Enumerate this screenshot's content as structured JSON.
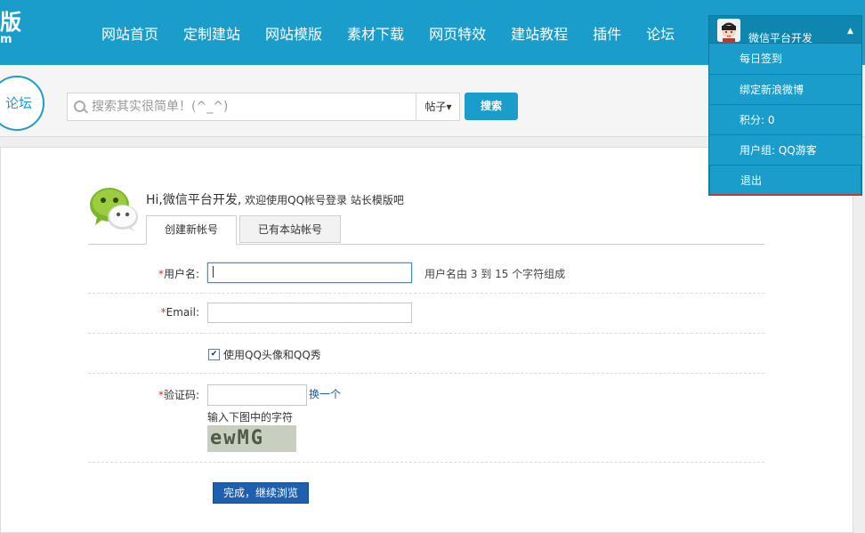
{
  "brand": {
    "line1": "版",
    "line2": "m"
  },
  "nav": {
    "items": [
      {
        "label": "网站首页"
      },
      {
        "label": "定制建站"
      },
      {
        "label": "网站模版"
      },
      {
        "label": "素材下载"
      },
      {
        "label": "网页特效"
      },
      {
        "label": "建站教程"
      },
      {
        "label": "插件"
      },
      {
        "label": "论坛"
      }
    ]
  },
  "user": {
    "name": "微信平台开发",
    "caret": "▲",
    "menu": [
      {
        "label": "每日签到"
      },
      {
        "label": "绑定新浪微博"
      },
      {
        "label": "积分: 0"
      },
      {
        "label": "用户组: QQ游客"
      },
      {
        "label": "退出"
      }
    ]
  },
  "search": {
    "badge": "论坛",
    "placeholder": "搜索其实很简单！(^_^)",
    "type_label": "帖子▾",
    "button_label": "搜索"
  },
  "register": {
    "greeting": "Hi,微信平台开发,",
    "greeting_tail": " 欢迎使用QQ帐号登录 站长模版吧",
    "tabs": [
      {
        "label": "创建新帐号"
      },
      {
        "label": "已有本站帐号"
      }
    ],
    "required_mark": "*",
    "username_label": "用户名:",
    "username_hint": "用户名由 3 到 15 个字符组成",
    "email_label": "Email:",
    "use_qq_label": "使用QQ头像和QQ秀",
    "use_qq_checked": true,
    "captcha_label": "验证码:",
    "captcha_change": "换一个",
    "captcha_hint": "输入下图中的字符",
    "captcha_text": "ewMG",
    "submit_label": "完成，继续浏览"
  },
  "colors": {
    "header": "#1a9dcb",
    "submit": "#1f5fb0",
    "required": "#e0312a",
    "active_menu_border": "#c23b3b"
  }
}
